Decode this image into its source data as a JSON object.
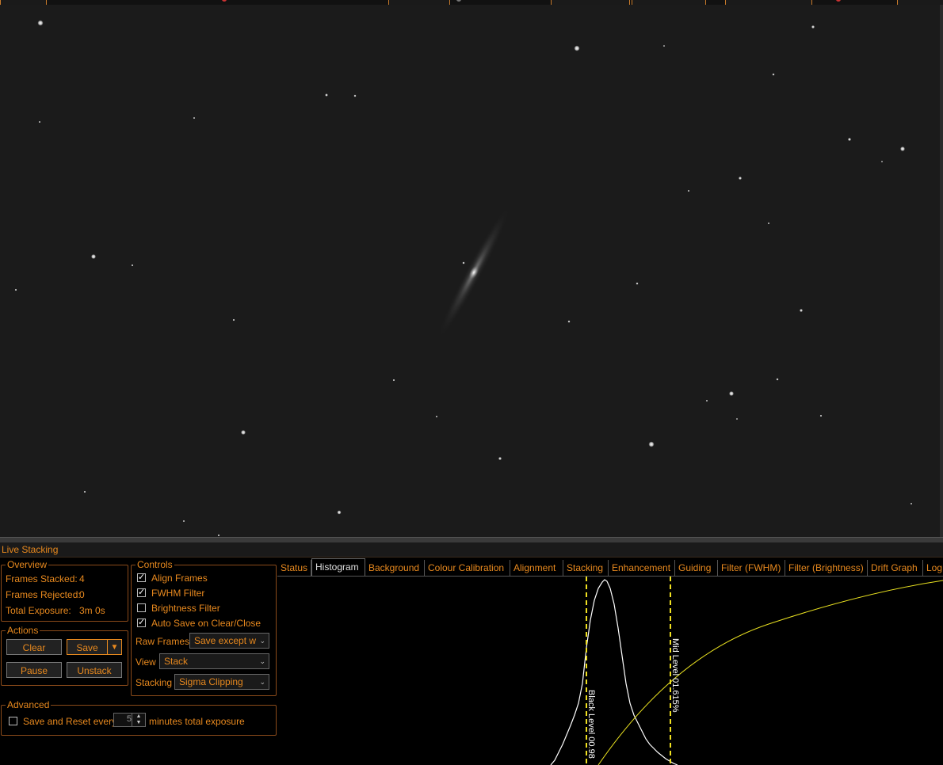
{
  "panel": {
    "title": "Live Stacking"
  },
  "overview": {
    "legend": "Overview",
    "frames_stacked_label": "Frames Stacked:",
    "frames_stacked": "4",
    "frames_rejected_label": "Frames Rejected:",
    "frames_rejected": "0",
    "total_exposure_label": "Total Exposure:",
    "total_exposure": "3m 0s"
  },
  "actions": {
    "legend": "Actions",
    "clear": "Clear",
    "save": "Save",
    "pause": "Pause",
    "unstack": "Unstack"
  },
  "controls": {
    "legend": "Controls",
    "align_frames": {
      "label": "Align Frames",
      "checked": true
    },
    "fwhm_filter": {
      "label": "FWHM Filter",
      "checked": true
    },
    "brightness_filter": {
      "label": "Brightness Filter",
      "checked": false
    },
    "auto_save": {
      "label": "Auto Save on Clear/Close",
      "checked": true
    },
    "raw_frames_label": "Raw Frames",
    "raw_frames_value": "Save except w",
    "view_label": "View",
    "view_value": "Stack",
    "stacking_label": "Stacking",
    "stacking_value": "Sigma Clipping"
  },
  "advanced": {
    "legend": "Advanced",
    "save_reset_label": "Save and Reset every",
    "save_reset_value": "5",
    "suffix": "minutes total exposure"
  },
  "tabs": [
    "Status",
    "Histogram",
    "Background",
    "Colour Calibration",
    "Alignment",
    "Stacking",
    "Enhancement",
    "Guiding",
    "Filter (FWHM)",
    "Filter (Brightness)",
    "Drift Graph",
    "Log"
  ],
  "active_tab": "Histogram",
  "histogram": {
    "black_level_label": "Black Level  00.98",
    "mid_level_label": "Mid Level  01.615%"
  },
  "colors": {
    "accent": "#e8891e",
    "background": "#000000",
    "marker": "#f0e020"
  }
}
